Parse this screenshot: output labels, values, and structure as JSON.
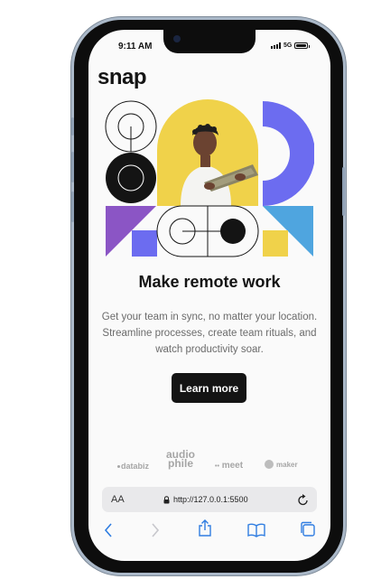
{
  "status": {
    "time": "9:11 AM",
    "network": "5G"
  },
  "brand": {
    "logo": "snap"
  },
  "hero": {
    "headline": "Make remote work",
    "description": "Get your team in sync, no matter your location. Streamline processes, create team rituals, and watch productivity soar.",
    "cta_label": "Learn more"
  },
  "partners": {
    "databiz": "databiz",
    "audiophile_top": "audio",
    "audiophile_bottom": "phile",
    "meet": "meet",
    "maker": "maker"
  },
  "browser": {
    "text_size_label": "AA",
    "url": "http://127.0.0.1:5500"
  },
  "colors": {
    "purple": "#8b55c5",
    "blue": "#6c6cf0",
    "sky": "#4fa5df",
    "yellow": "#f0d24a",
    "dark": "#141414"
  }
}
